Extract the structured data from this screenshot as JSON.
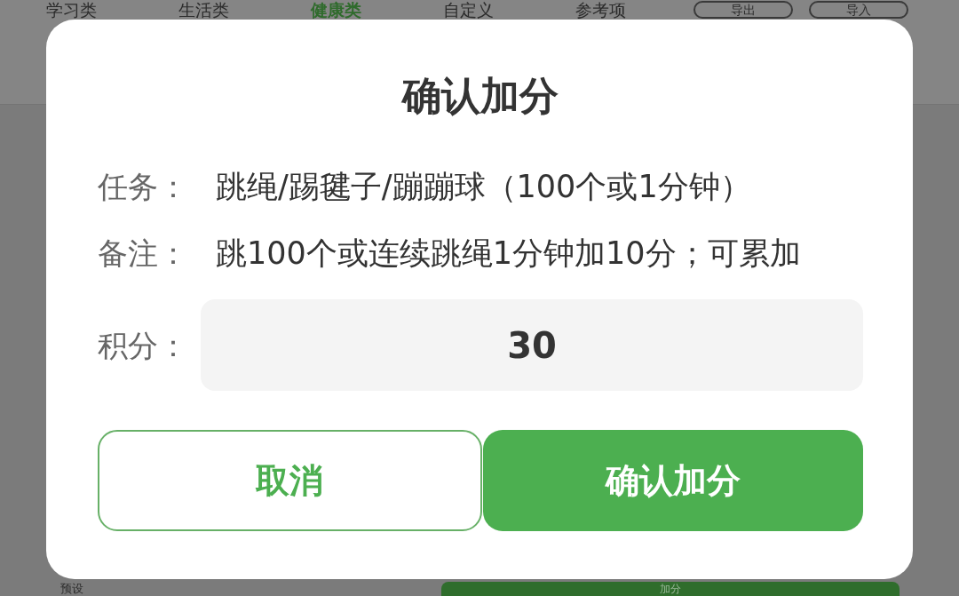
{
  "background": {
    "tabs": [
      {
        "label": "学习类",
        "selected": false
      },
      {
        "label": "生活类",
        "selected": false
      },
      {
        "label": "健康类",
        "selected": true
      },
      {
        "label": "自定义",
        "selected": false
      },
      {
        "label": "参考项",
        "selected": false
      }
    ],
    "actions": [
      "导出",
      "导入"
    ],
    "footer": {
      "label": "预设",
      "button": "加分"
    }
  },
  "dialog": {
    "title": "确认加分",
    "fields": [
      {
        "label": "任务：",
        "value": "跳绳/踢毽子/蹦蹦球（100个或1分钟）"
      },
      {
        "label": "备注：",
        "value": "跳100个或连续跳绳1分钟加10分；可累加"
      }
    ],
    "score": {
      "label": "积分：",
      "value": "30"
    },
    "buttons": [
      {
        "label": "取消",
        "kind": "secondary"
      },
      {
        "label": "确认加分",
        "kind": "primary"
      }
    ]
  }
}
